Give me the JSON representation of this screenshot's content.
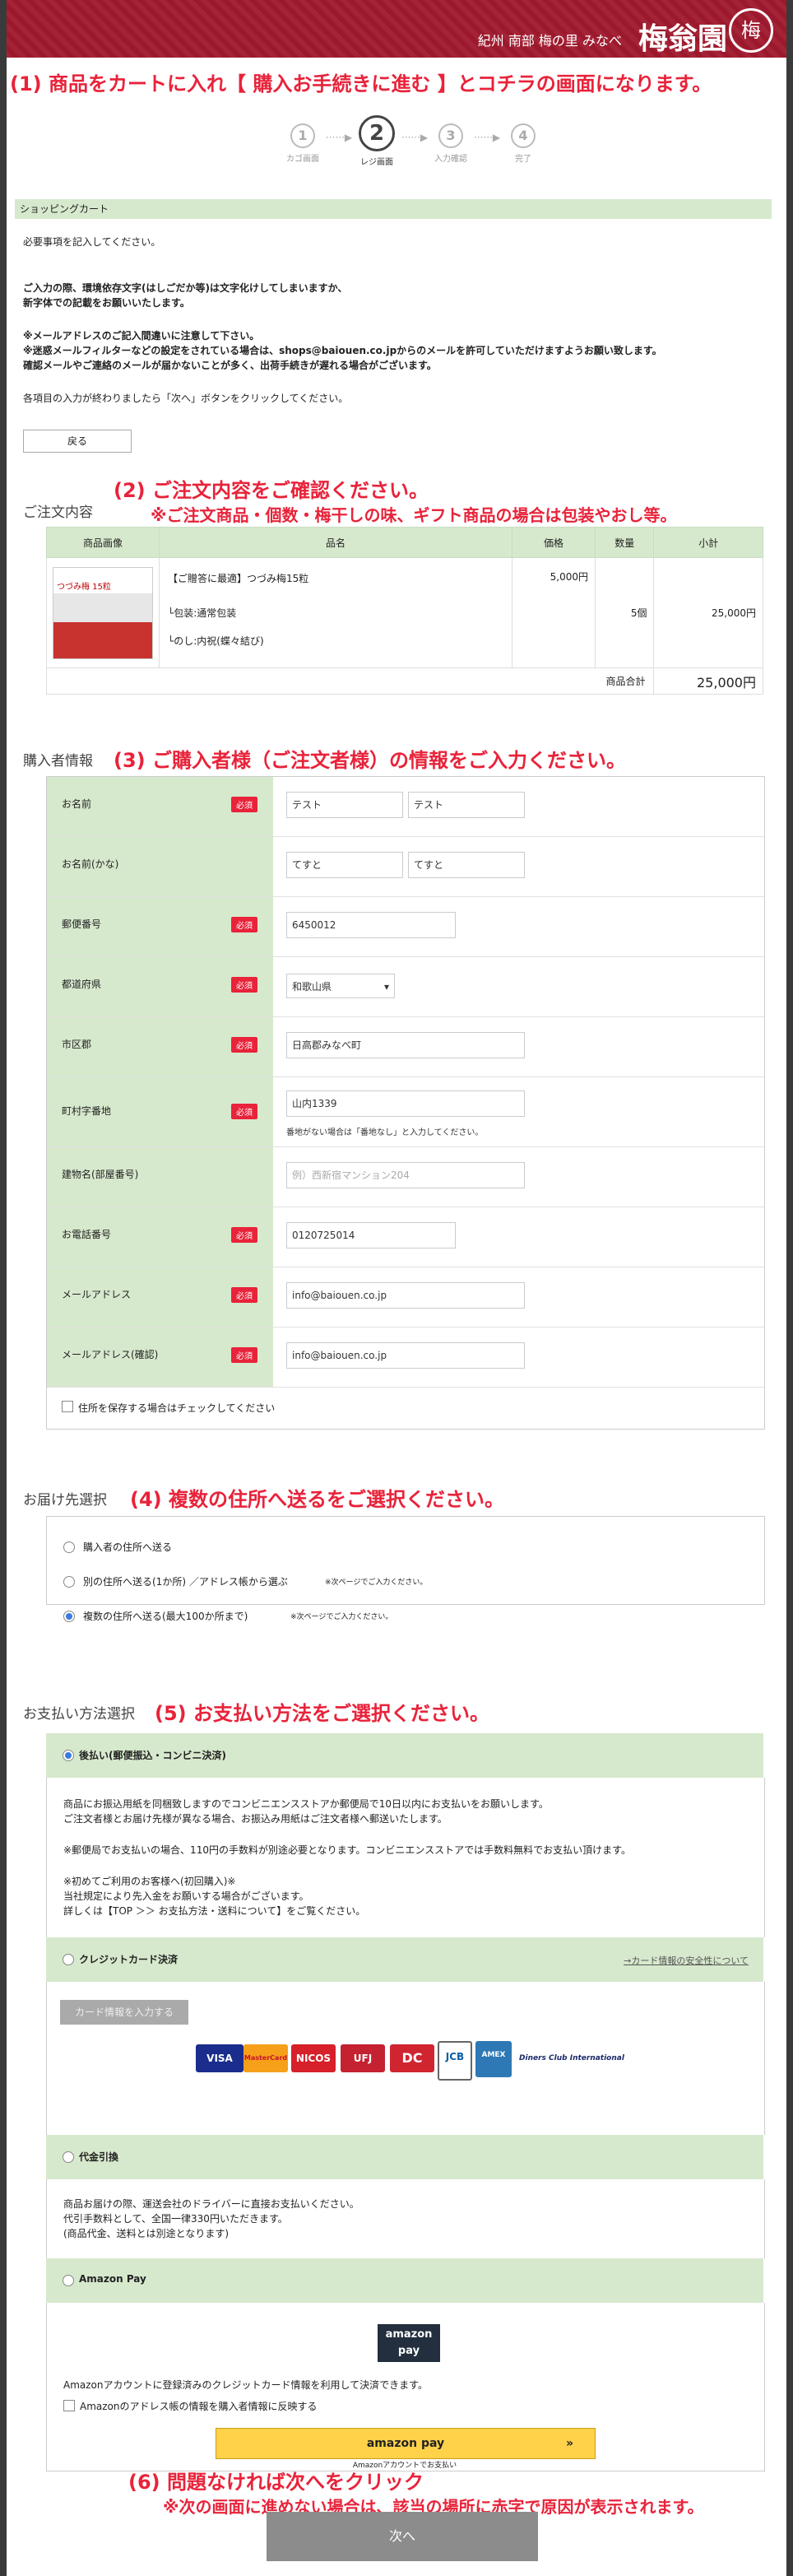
{
  "header": {
    "tagline": "紀州 南部 梅の里 みなべ",
    "logo": "梅翁園",
    "mark": "梅"
  },
  "annotations": {
    "a1": "(1) 商品をカートに入れ【 購入お手続きに進む 】とコチラの画面になります。",
    "a2": "(2) ご注文内容をご確認ください。",
    "a2b": "※ご注文商品・個数・梅干しの味、ギフト商品の場合は包装やおし等。",
    "a3": "(3) ご購入者様（ご注文者様）の情報をご入力ください。",
    "a4": "(4) 複数の住所へ送るをご選択ください。",
    "a5": "(5) お支払い方法をご選択ください。",
    "a6": "(6) 問題なければ次へをクリック",
    "a6b": "※次の画面に進めない場合は、該当の場所に赤字で原因が表示されます。"
  },
  "steps": [
    {
      "num": "1",
      "label": "カゴ画面"
    },
    {
      "num": "2",
      "label": "レジ画面"
    },
    {
      "num": "3",
      "label": "入力確認"
    },
    {
      "num": "4",
      "label": "完了"
    }
  ],
  "cart": {
    "bar": "ショッピングカート",
    "p1": "必要事項を記入してください。",
    "p2a": "ご入力の際、環境依存文字(はしごだか等)は文字化けしてしまいますか、",
    "p2b": "新字体での記載をお願いいたします。",
    "p3a": "※メールアドレスのご記入間違いに注意して下さい。",
    "p3b": "※迷惑メールフィルターなどの設定をされている場合は、shops@baiouen.co.jpからのメールを許可していただけますようお願い致します。",
    "p3c": "確認メールやご連絡のメールが届かないことが多く、出荷手続きが遅れる場合がございます。",
    "p4": "各項目の入力が終わりましたら「次へ」ボタンをクリックしてください。",
    "back": "戻る"
  },
  "order": {
    "title": "ご注文内容",
    "headers": [
      "商品画像",
      "品名",
      "価格",
      "数量",
      "小計"
    ],
    "image_text": "つづみ梅 15粒",
    "name": "【ご贈答に最適】つづみ梅15粒",
    "opt1": "└包装:通常包装",
    "opt2": "└のし:内祝(蝶々結び)",
    "price": "5,000円",
    "qty": "5個",
    "subtotal": "25,000円",
    "total_label": "商品合計",
    "total": "25,000円"
  },
  "buyer": {
    "title": "購入者情報",
    "req": "必須",
    "name_label": "お名前",
    "last": "テスト",
    "first": "テスト",
    "kana_label": "お名前(かな)",
    "kana_last": "てすと",
    "kana_first": "てすと",
    "zip_label": "郵便番号",
    "zip": "6450012",
    "pref_label": "都道府県",
    "pref": "和歌山県",
    "city_label": "市区郡",
    "city": "日高郡みなべ町",
    "addr_label": "町村字番地",
    "addr": "山内1339",
    "addr_note": "番地がない場合は「番地なし」と入力してください。",
    "bld_label": "建物名(部屋番号)",
    "bld_ph": "例）西新宿マンション204",
    "tel_label": "お電話番号",
    "tel": "0120725014",
    "mail_label": "メールアドレス",
    "mail": "info@baiouen.co.jp",
    "mail2_label": "メールアドレス(確認)",
    "mail2": "info@baiouen.co.jp",
    "save": "住所を保存する場合はチェックしてください"
  },
  "delivery": {
    "title": "お届け先選択",
    "o1": "購入者の住所へ送る",
    "o2": "別の住所へ送る(1か所) ／アドレス帳から選ぶ",
    "o2n": "※次ページでご入力ください。",
    "o3": "複数の住所へ送る(最大100か所まで)",
    "o3n": "※次ページでご入力ください。"
  },
  "payment": {
    "title": "お支払い方法選択",
    "m1": "後払い(郵便振込・コンビニ決済)",
    "m1a": "商品にお振込用紙を同梱致しますのでコンビニエンスストアか郵便局で10日以内にお支払いをお願いします。",
    "m1b": "ご注文者様とお届け先様が異なる場合、お振込み用紙はご注文者様へ郵送いたします。",
    "m1c": "※郵便局でお支払いの場合、110円の手数料が別途必要となります。コンビニエンスストアでは手数料無料でお支払い頂けます。",
    "m1d": "※初めてご利用のお客様へ(初回購入)※",
    "m1e": "当社規定により先入金をお願いする場合がございます。",
    "m1f": "詳しくは【TOP ＞＞ お支払方法・送料について】をご覧ください。",
    "m2": "クレジットカード決済",
    "m2link": "→カード情報の安全性について",
    "m2btn": "カード情報を入力する",
    "cards": [
      "VISA",
      "MasterCard",
      "NICOS",
      "UFJ",
      "DC",
      "JCB",
      "AMEX",
      "Diners Club International"
    ],
    "m3": "代金引換",
    "m3a": "商品お届けの際、運送会社のドライバーに直接お支払いください。",
    "m3b": "代引手数料として、全国一律330円いただきます。",
    "m3c": "(商品代金、送料とは別途となります)",
    "m4": "Amazon Pay",
    "m4logo": "amazon pay",
    "m4a": "Amazonアカウントに登録済みのクレジットカード情報を利用して決済できます。",
    "m4b": "Amazonのアドレス帳の情報を購入者情報に反映する",
    "m4btn": "amazon pay",
    "m4btn_sub": "Amazonアカウントでお支払い",
    "next": "次へ"
  }
}
